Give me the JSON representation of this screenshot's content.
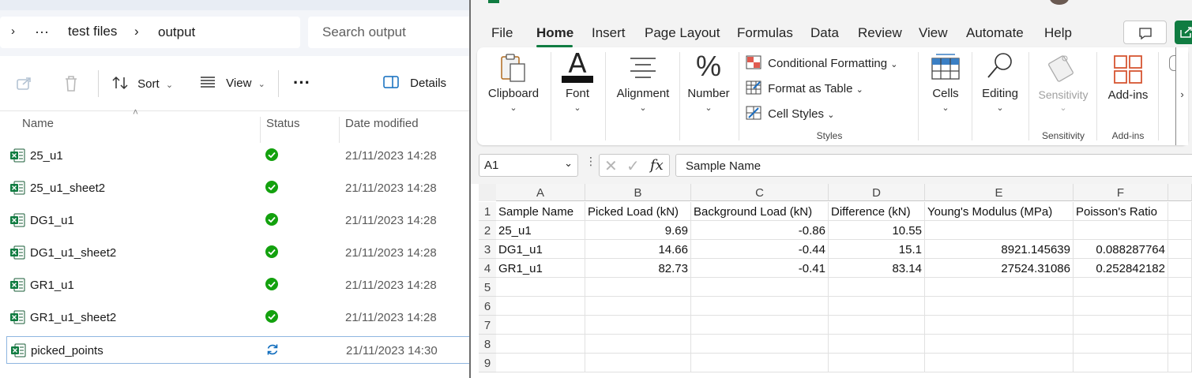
{
  "explorer": {
    "breadcrumb": {
      "overflow": "···",
      "items": [
        "test files",
        "output"
      ]
    },
    "search": {
      "placeholder": "Search output"
    },
    "toolbar": {
      "sort_label": "Sort",
      "view_label": "View",
      "more_label": "···",
      "details_label": "Details"
    },
    "columns": {
      "name": "Name",
      "status": "Status",
      "date": "Date modified"
    },
    "files": [
      {
        "name": "25_u1",
        "status": "synced",
        "date": "21/11/2023 14:28"
      },
      {
        "name": "25_u1_sheet2",
        "status": "synced",
        "date": "21/11/2023 14:28"
      },
      {
        "name": "DG1_u1",
        "status": "synced",
        "date": "21/11/2023 14:28"
      },
      {
        "name": "DG1_u1_sheet2",
        "status": "synced",
        "date": "21/11/2023 14:28"
      },
      {
        "name": "GR1_u1",
        "status": "synced",
        "date": "21/11/2023 14:28"
      },
      {
        "name": "GR1_u1_sheet2",
        "status": "synced",
        "date": "21/11/2023 14:28"
      },
      {
        "name": "picked_points",
        "status": "syncing",
        "date": "21/11/2023 14:30"
      }
    ]
  },
  "excel": {
    "menu": [
      "File",
      "Home",
      "Insert",
      "Page Layout",
      "Formulas",
      "Data",
      "Review",
      "View",
      "Automate",
      "Help"
    ],
    "ribbon": {
      "clipboard": "Clipboard",
      "font": "Font",
      "alignment": "Alignment",
      "number": "Number",
      "conditional_formatting": "Conditional Formatting",
      "format_as_table": "Format as Table",
      "cell_styles": "Cell Styles",
      "styles_caption": "Styles",
      "cells": "Cells",
      "editing": "Editing",
      "sensitivity": "Sensitivity",
      "sensitivity_caption": "Sensitivity",
      "addins": "Add-ins",
      "addins_caption": "Add-ins"
    },
    "namebox": "A1",
    "formula": "Sample Name",
    "columns": [
      "A",
      "B",
      "C",
      "D",
      "E",
      "F"
    ],
    "rows": [
      "1",
      "2",
      "3",
      "4",
      "5",
      "6",
      "7",
      "8",
      "9"
    ],
    "cells": [
      [
        "Sample Name",
        "Picked Load (kN)",
        "Background Load (kN)",
        "Difference (kN)",
        "Young's Modulus (MPa)",
        "Poisson's Ratio"
      ],
      [
        "25_u1",
        "9.69",
        "-0.86",
        "10.55",
        "",
        ""
      ],
      [
        "DG1_u1",
        "14.66",
        "-0.44",
        "15.1",
        "8921.145639",
        "0.088287764"
      ],
      [
        "GR1_u1",
        "82.73",
        "-0.41",
        "83.14",
        "27524.31086",
        "0.252842182"
      ]
    ]
  },
  "colors": {
    "accent_green": "#107c41",
    "sync_green": "#13a10e",
    "sync_blue": "#0f6cbd"
  }
}
